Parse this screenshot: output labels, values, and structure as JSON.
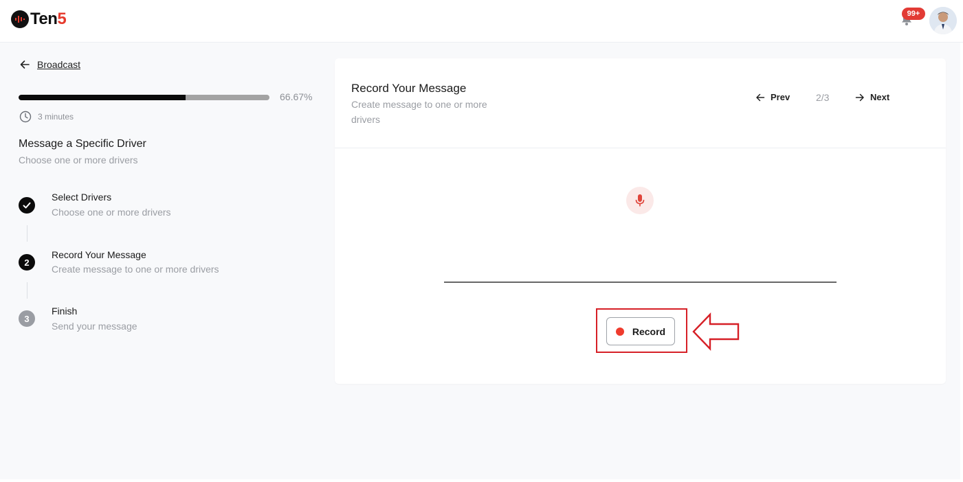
{
  "header": {
    "logo": {
      "part1": "Ten",
      "part2": "5"
    },
    "notifications_badge": "99+"
  },
  "sidebar": {
    "back_label": "Broadcast",
    "progress": {
      "percent": 66.67,
      "label": "66.67%"
    },
    "duration": "3 minutes",
    "flow_title": "Message a Specific Driver",
    "flow_subtitle": "Choose one or more drivers",
    "steps": [
      {
        "marker": "✓",
        "title": "Select Drivers",
        "subtitle": "Choose one or more drivers",
        "state": "complete"
      },
      {
        "marker": "2",
        "title": "Record Your Message",
        "subtitle": "Create message to one or more drivers",
        "state": "current"
      },
      {
        "marker": "3",
        "title": "Finish",
        "subtitle": "Send your message",
        "state": "upcoming"
      }
    ]
  },
  "card": {
    "title": "Record Your Message",
    "subtitle": "Create message to one or more drivers",
    "prev_label": "Prev",
    "next_label": "Next",
    "page_indicator": "2/3",
    "record_label": "Record"
  },
  "colors": {
    "accent_red": "#e63b2e",
    "record_dot": "#ef3b2d",
    "highlight_box": "#d61f26",
    "step_active": "#0b0b0b",
    "step_upcoming": "#9a9da3"
  },
  "icons": {
    "back": "arrow-left-icon",
    "clock": "clock-icon",
    "bell": "bell-icon",
    "mic": "microphone-icon",
    "prev": "arrow-left-icon",
    "next": "arrow-right-icon"
  }
}
